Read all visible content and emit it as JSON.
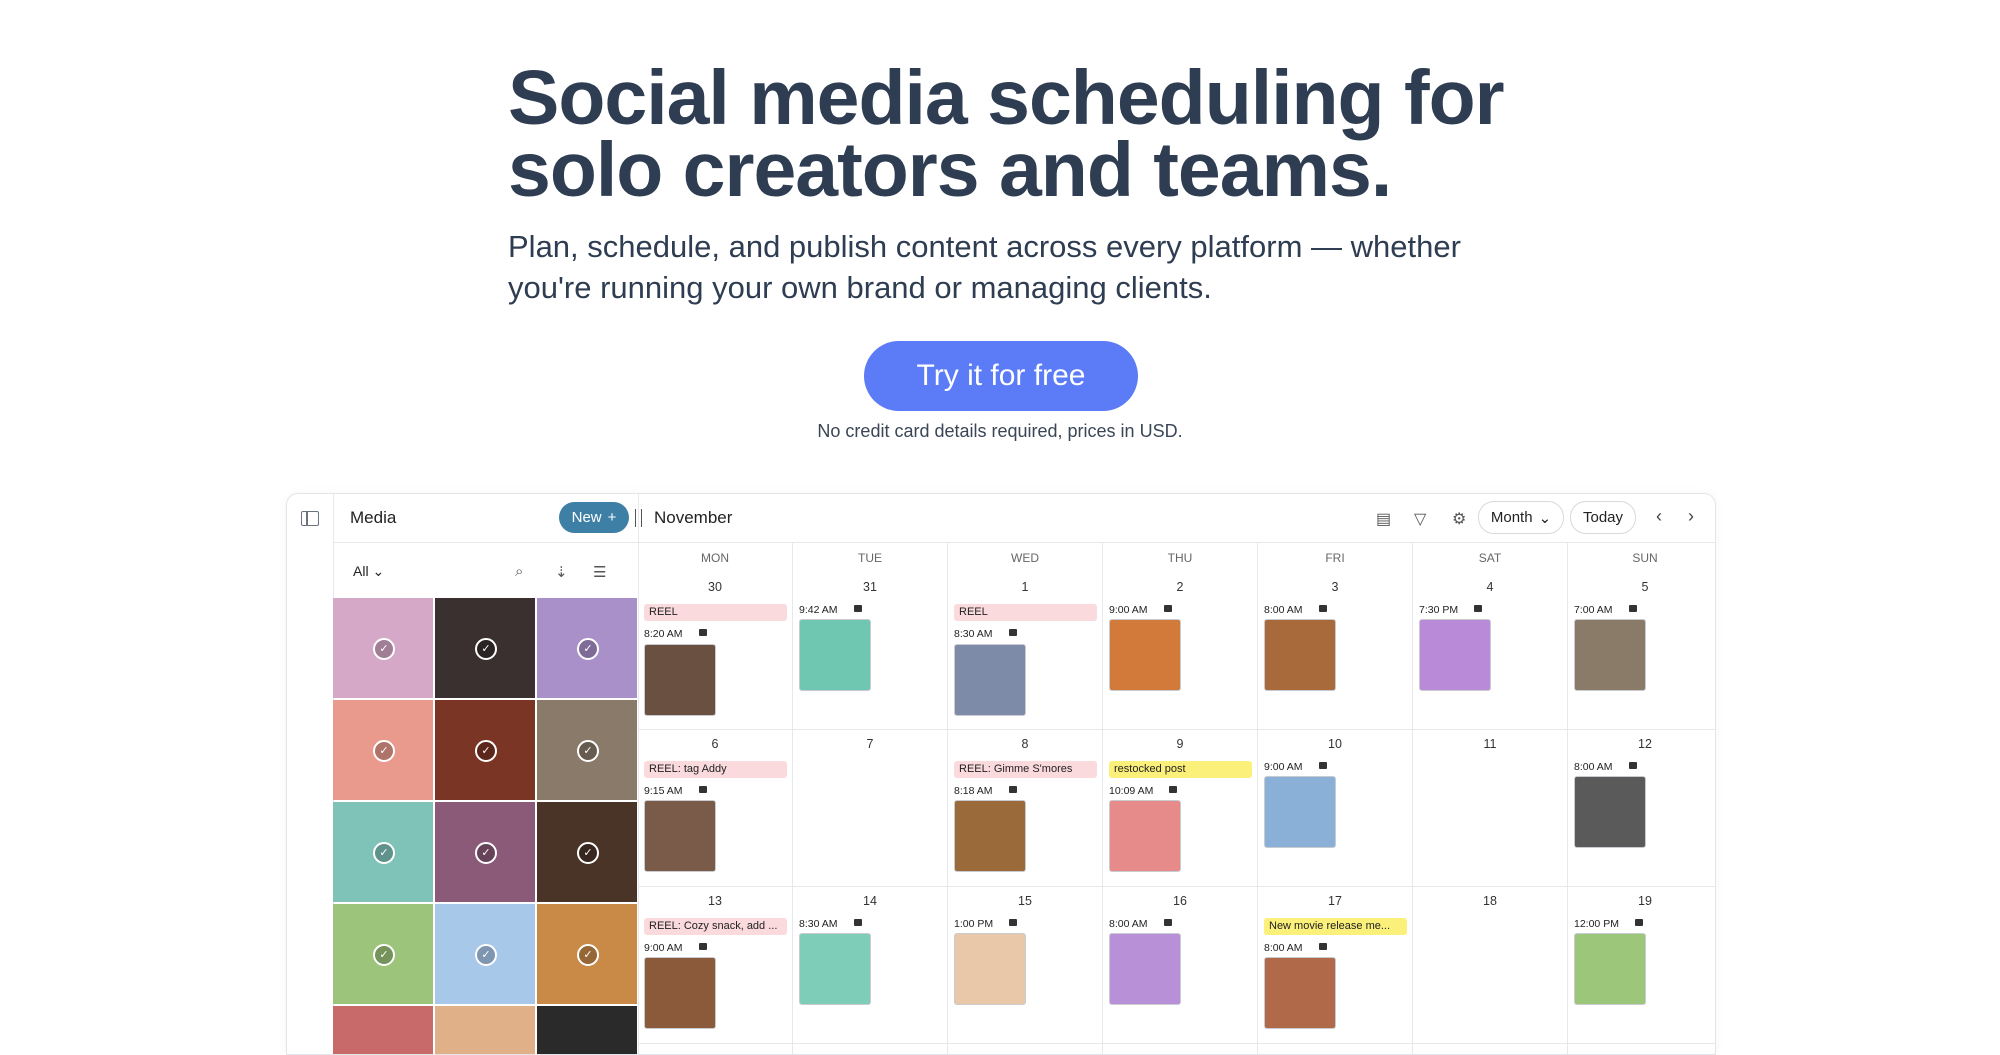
{
  "hero": {
    "title_line1": "Social media scheduling for",
    "title_line2": "solo creators and teams.",
    "subtitle_line1": "Plan, schedule, and publish content across every platform — whether",
    "subtitle_line2": "you're running your own brand or managing clients.",
    "cta": "Try it for free",
    "note": "No credit card details required, prices in USD."
  },
  "media": {
    "title": "Media",
    "new_label": "New",
    "new_icon": "plus-icon",
    "filter": "All",
    "icons": [
      "search-icon",
      "sort-icon",
      "list-icon"
    ]
  },
  "calendar": {
    "month": "November",
    "view": "Month",
    "today": "Today",
    "days": [
      "MON",
      "TUE",
      "WED",
      "THU",
      "FRI",
      "SAT",
      "SUN"
    ],
    "weeks": [
      [
        "30",
        "31",
        "1",
        "2",
        "3",
        "4",
        "5"
      ],
      [
        "6",
        "7",
        "8",
        "9",
        "10",
        "11",
        "12"
      ],
      [
        "13",
        "14",
        "15",
        "16",
        "17",
        "18",
        "19"
      ]
    ],
    "labels": {
      "mon30": "REEL",
      "wed1": "REEL",
      "mon6": "REEL: tag Addy",
      "wed8": "REEL: Gimme S'mores",
      "thu9": "restocked post",
      "mon13": "REEL: Cozy snack, add ...",
      "fri17": "New movie release me..."
    },
    "times": {
      "mon30": "8:20 AM",
      "tue31": "9:42 AM",
      "wed1": "8:30 AM",
      "thu2": "9:00 AM",
      "fri3": "8:00 AM",
      "sat4": "7:30 PM",
      "sun5": "7:00 AM",
      "mon6": "9:15 AM",
      "wed8": "8:18 AM",
      "thu9": "10:09 AM",
      "fri10": "9:00 AM",
      "sun12": "8:00 AM",
      "mon13": "9:00 AM",
      "tue14": "8:30 AM",
      "wed15": "1:00 PM",
      "thu16": "8:00 AM",
      "fri17": "8:00 AM",
      "sun19": "12:00 PM"
    },
    "icons": [
      "list-view-icon",
      "filter-icon",
      "settings-icon",
      "chevron-left-icon",
      "chevron-right-icon"
    ]
  },
  "colors": {
    "cta": "#5b7bf7",
    "new_button": "#3e7fa6",
    "label_pink": "#fadadd",
    "label_yellow": "#faf07a"
  }
}
